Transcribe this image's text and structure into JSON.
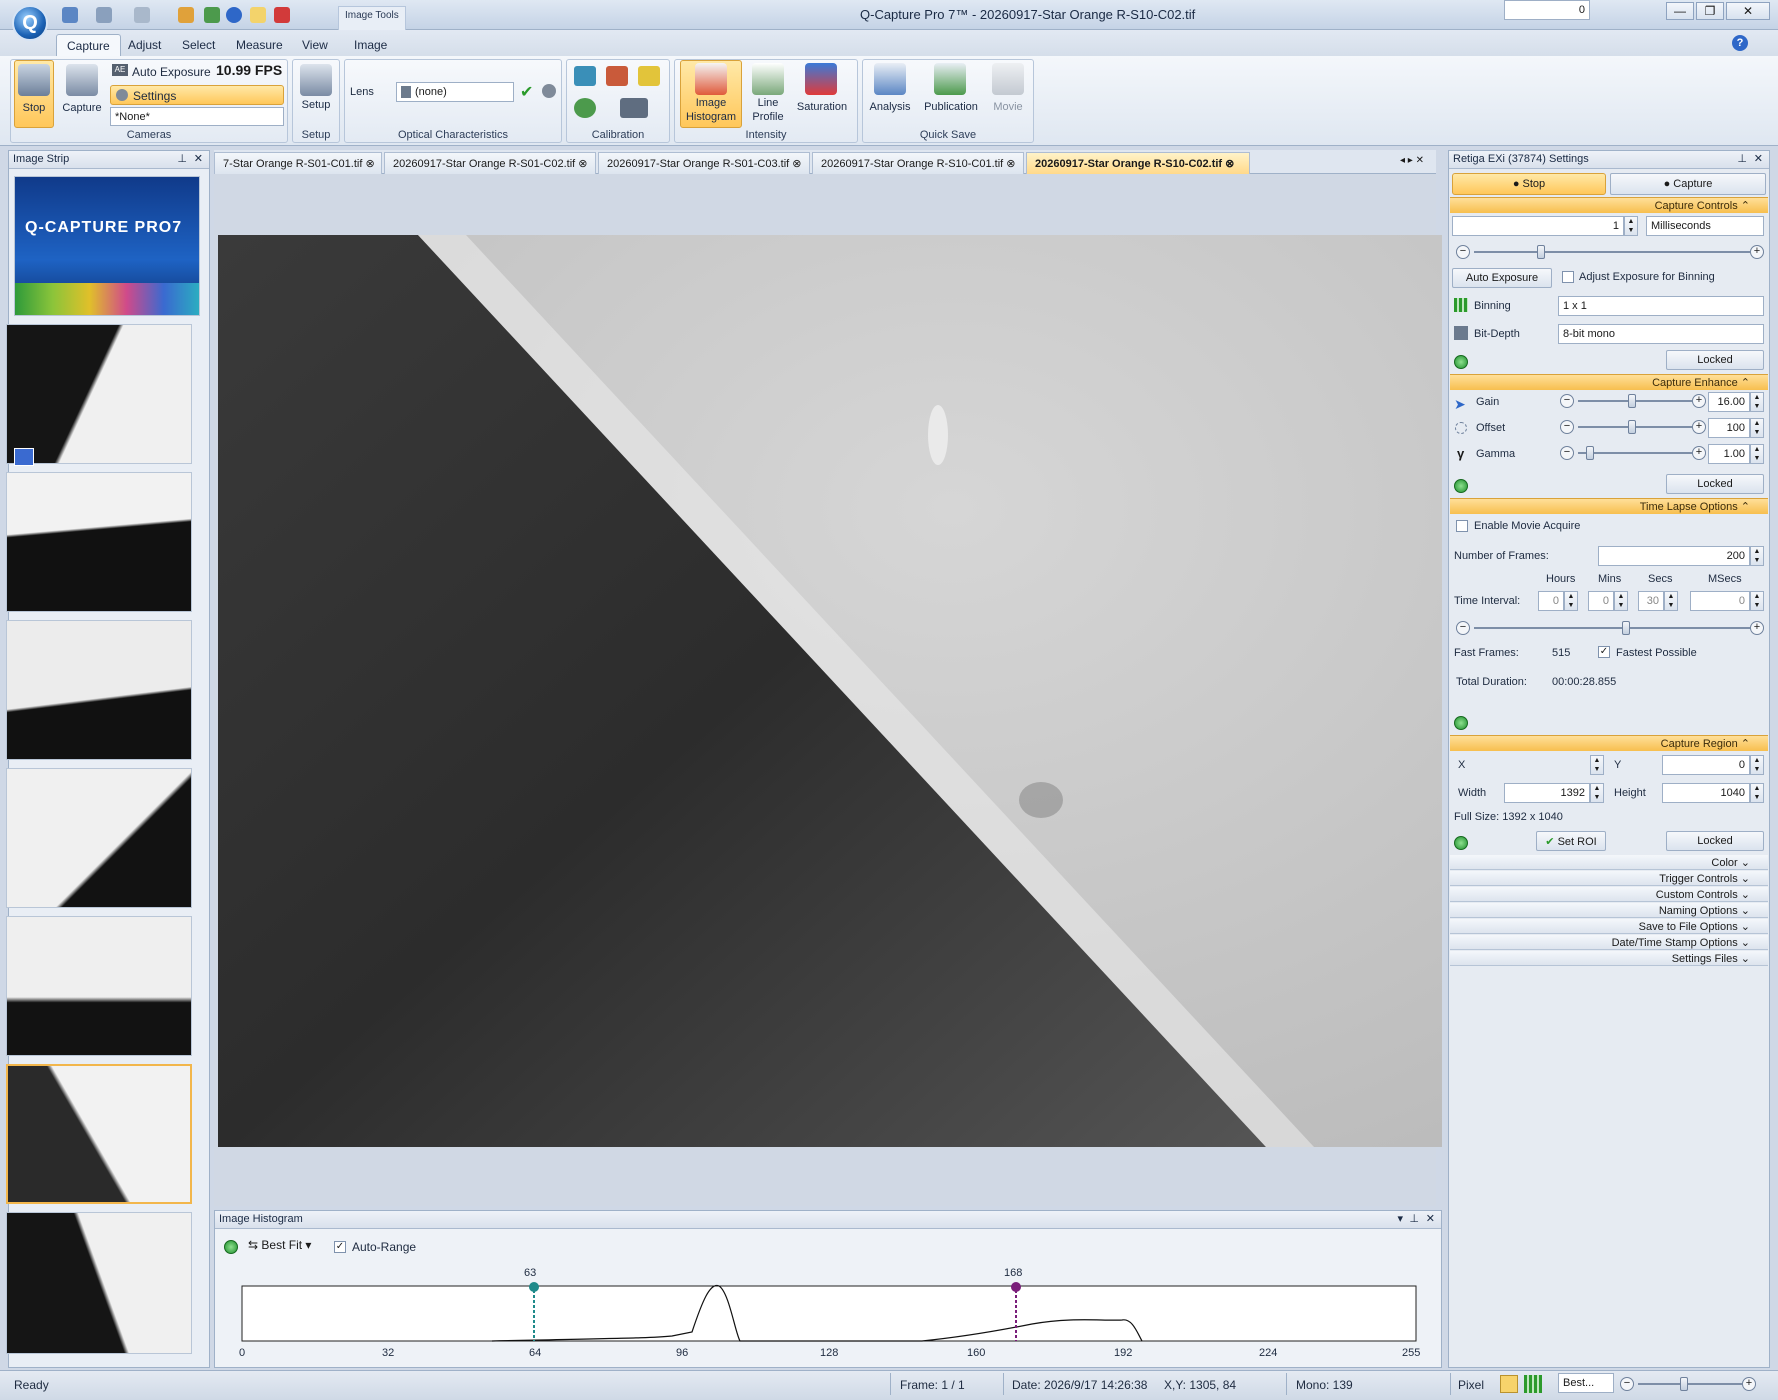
{
  "window": {
    "title": "Q-Capture Pro 7™ - 20260917-Star Orange R-S10-C02.tif",
    "image_tools_label": "Image Tools",
    "buttons": {
      "minimize": "—",
      "maximize": "❐",
      "close": "✕"
    }
  },
  "ribbon": {
    "tabs": [
      "Capture",
      "Adjust",
      "Select",
      "Measure",
      "View",
      "Image"
    ],
    "active_tab": "Capture",
    "cameras": {
      "stop_label": "Stop",
      "capture_label": "Capture",
      "auto_exposure_label": "Auto Exposure",
      "fps": "10.99 FPS",
      "settings_label": "Settings",
      "preset_value": "*None*",
      "group_label": "Cameras"
    },
    "setup": {
      "setup_label": "Setup",
      "group_label": "Setup"
    },
    "optical": {
      "lens_label": "Lens",
      "lens_value": "(none)",
      "group_label": "Optical Characteristics"
    },
    "calibration": {
      "group_label": "Calibration"
    },
    "intensity": {
      "histogram_label_1": "Image",
      "histogram_label_2": "Histogram",
      "line_label_1": "Line",
      "line_label_2": "Profile",
      "saturation_label": "Saturation",
      "group_label": "Intensity"
    },
    "quicksave": {
      "analysis_label": "Analysis",
      "publication_label": "Publication",
      "movie_label": "Movie",
      "group_label": "Quick Save"
    }
  },
  "strip": {
    "title": "Image Strip",
    "logo_text": "Q-CAPTURE PRO7",
    "logo_sub": "Q-CAPTURE PRO7"
  },
  "doc_tabs": [
    "7-Star Orange R-S01-C01.tif",
    "20260917-Star Orange R-S01-C02.tif",
    "20260917-Star Orange R-S01-C03.tif",
    "20260917-Star Orange R-S10-C01.tif",
    "20260917-Star Orange R-S10-C02.tif"
  ],
  "histogram": {
    "title": "Image Histogram",
    "fit_label": "Best Fit",
    "autorange_label": "Auto-Range",
    "low_marker": "63",
    "high_marker": "168",
    "ticks": [
      "0",
      "32",
      "64",
      "96",
      "128",
      "160",
      "192",
      "224",
      "255"
    ]
  },
  "settings": {
    "title": "Retiga EXi (37874) Settings",
    "stop_label": "Stop",
    "capture_label": "Capture",
    "capture_controls": {
      "header": "Capture Controls",
      "exposure_value": "1",
      "exposure_unit": "Milliseconds",
      "auto_exposure_btn": "Auto Exposure",
      "adjust_binning_label": "Adjust Exposure for Binning",
      "binning_label": "Binning",
      "binning_value": "1 x 1",
      "bitdepth_label": "Bit-Depth",
      "bitdepth_value": "8-bit mono",
      "lock_value": "Locked"
    },
    "capture_enhance": {
      "header": "Capture Enhance",
      "gain_label": "Gain",
      "gain_value": "16.00",
      "offset_label": "Offset",
      "offset_value": "100",
      "gamma_label": "Gamma",
      "gamma_value": "1.00",
      "lock_value": "Locked"
    },
    "time_lapse": {
      "header": "Time Lapse Options",
      "enable_movie_label": "Enable Movie Acquire",
      "frames_label": "Number of  Frames:",
      "frames_value": "200",
      "hours_label": "Hours",
      "mins_label": "Mins",
      "secs_label": "Secs",
      "msecs_label": "MSecs",
      "interval_label": "Time Interval:",
      "hours_value": "0",
      "mins_value": "0",
      "secs_value": "30",
      "msecs_value": "0",
      "fast_frames_label": "Fast Frames:",
      "fast_frames_value": "515",
      "fastest_label": "Fastest Possible",
      "duration_label": "Total Duration:",
      "duration_value": "00:00:28.855"
    },
    "capture_region": {
      "header": "Capture Region",
      "x_label": "X",
      "x_value": "0",
      "y_label": "Y",
      "y_value": "0",
      "width_label": "Width",
      "width_value": "1392",
      "height_label": "Height",
      "height_value": "1040",
      "full_size": "Full Size: 1392 x 1040",
      "set_roi_label": "Set ROI",
      "lock_value": "Locked"
    },
    "collapsed_sections": [
      "Color",
      "Trigger Controls",
      "Custom Controls",
      "Naming Options",
      "Save to File Options",
      "Date/Time Stamp Options",
      "Settings Files"
    ]
  },
  "status": {
    "ready": "Ready",
    "frame": "Frame: 1 / 1",
    "date": "Date: 2026/9/17 14:26:38",
    "xy": "X,Y: 1305,   84",
    "mono": "Mono:   139",
    "pixel": "Pixel",
    "zoom": "Best..."
  },
  "colors": {
    "accent": "#f7bf4f",
    "ribbon": "#dfe7f1",
    "frame": "#9fb1c8"
  }
}
